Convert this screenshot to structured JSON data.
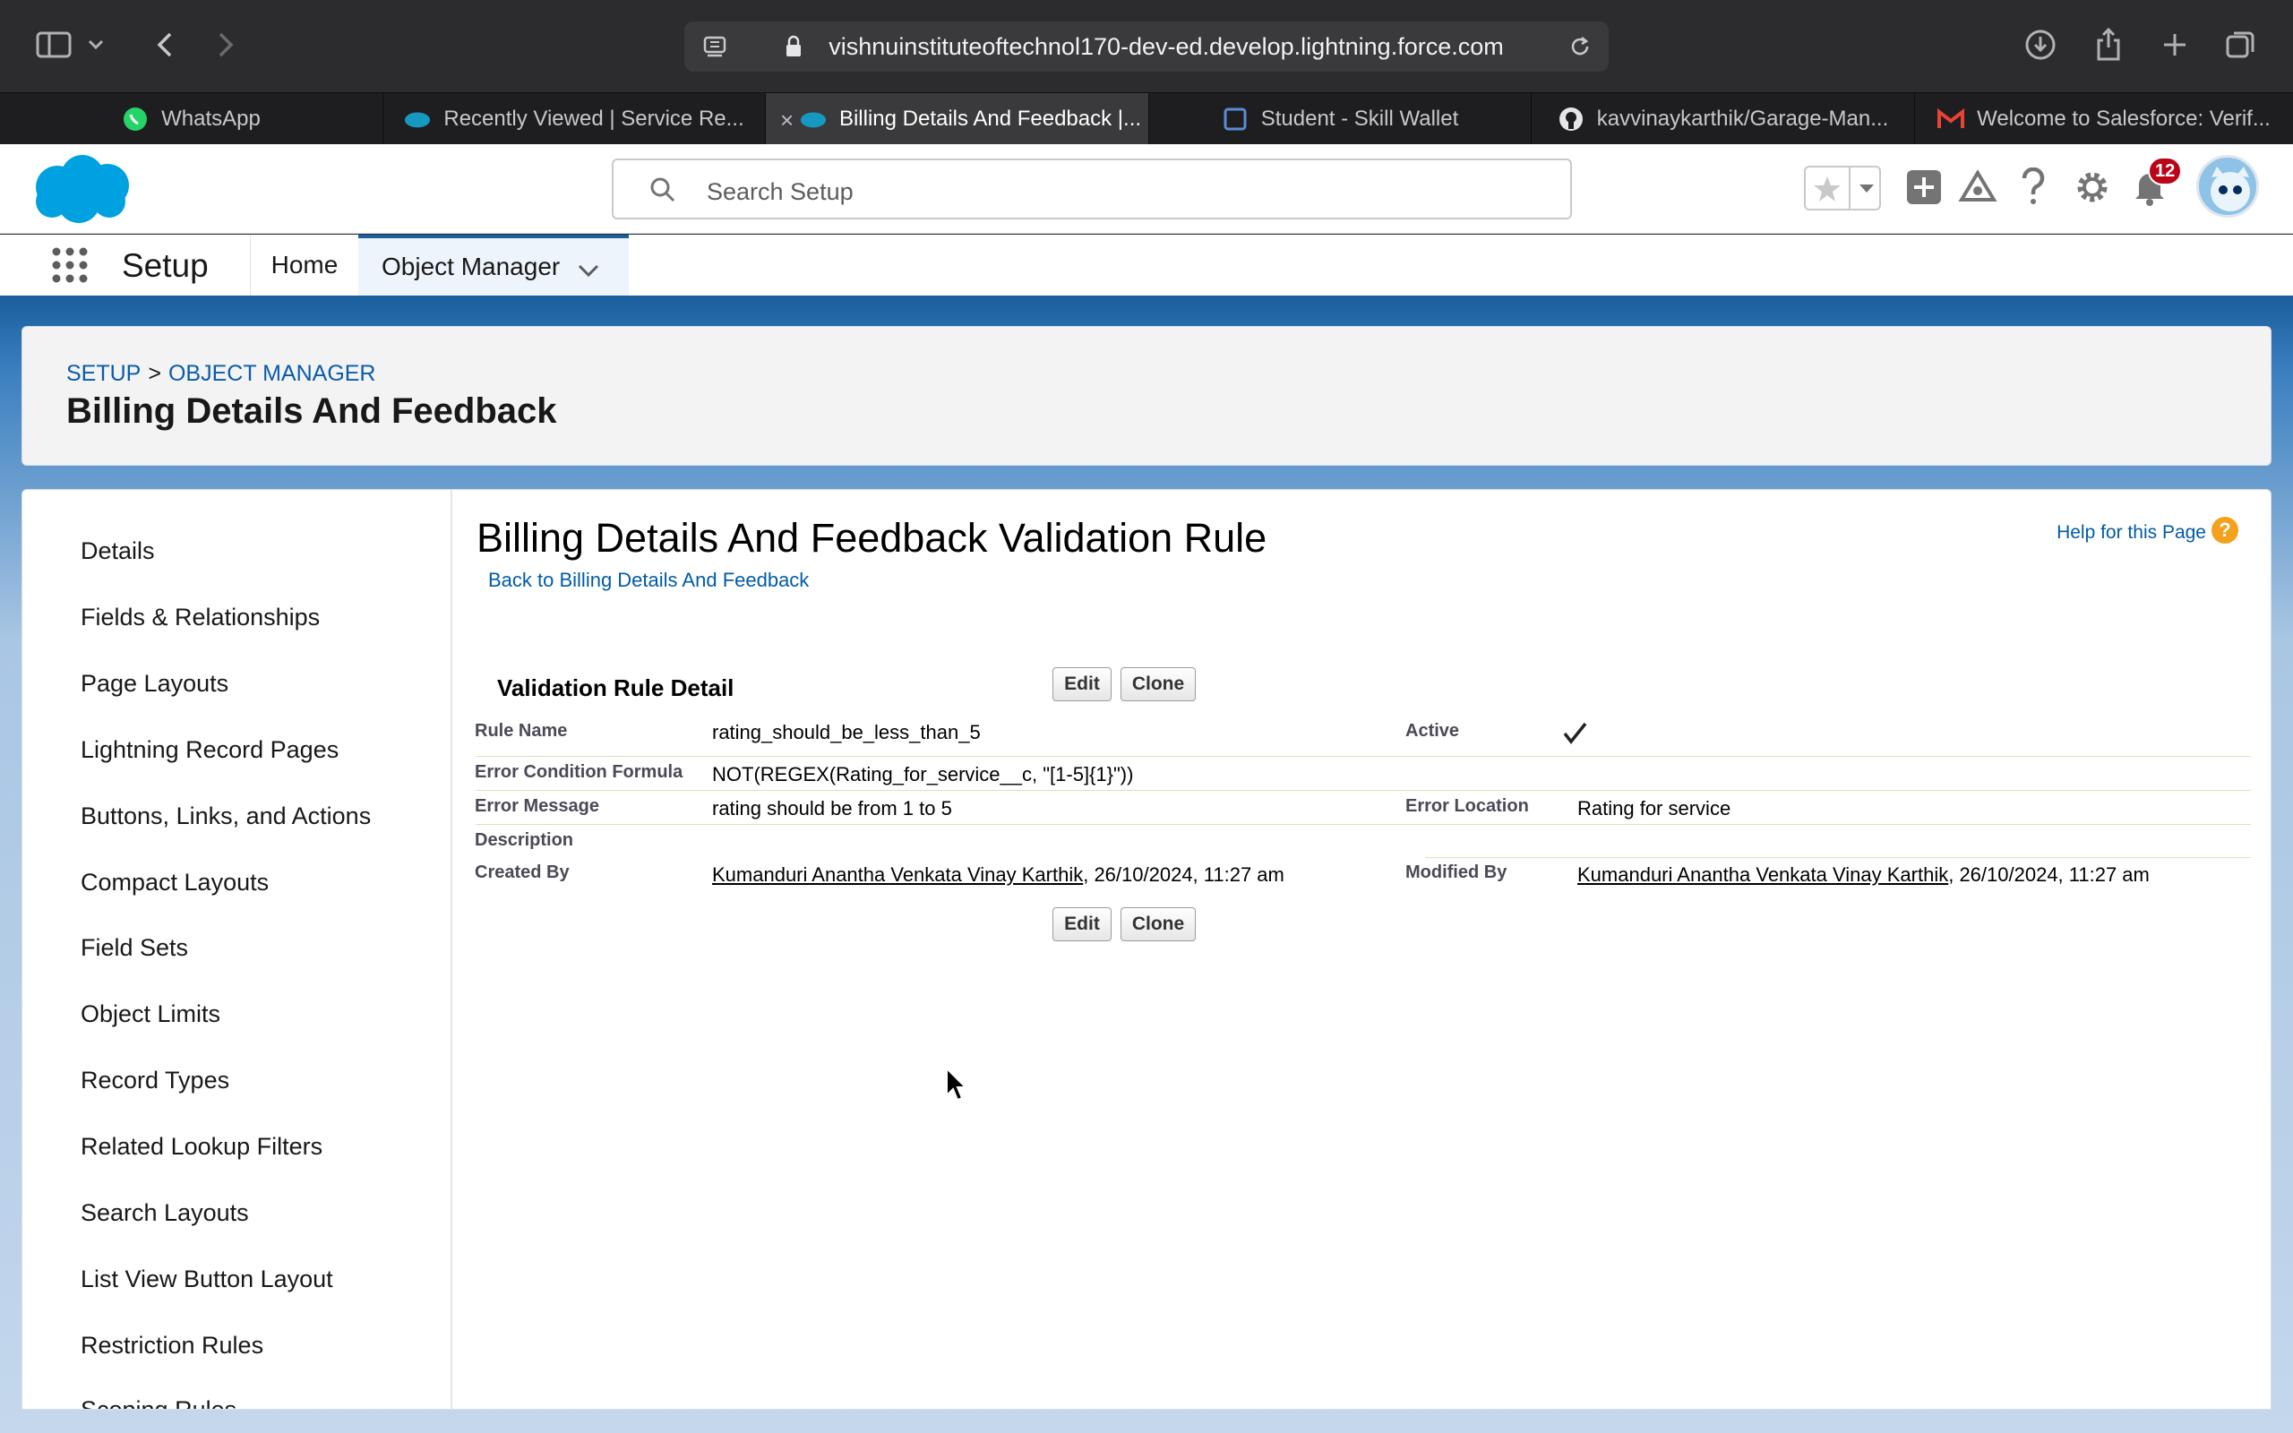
{
  "browser": {
    "url": "vishnuinstituteoftechnol170-dev-ed.develop.lightning.force.com",
    "tabs": [
      {
        "label": "WhatsApp",
        "icon": "whatsapp-icon"
      },
      {
        "label": "Recently Viewed | Service Re...",
        "icon": "salesforce-cloud-icon"
      },
      {
        "label": "Billing Details And Feedback |...",
        "icon": "salesforce-cloud-icon",
        "active": true
      },
      {
        "label": "Student - Skill Wallet",
        "icon": "skill-wallet-icon"
      },
      {
        "label": "kavvinaykarthik/Garage-Man...",
        "icon": "github-icon"
      },
      {
        "label": "Welcome to Salesforce: Verif...",
        "icon": "gmail-icon"
      }
    ]
  },
  "header": {
    "search_placeholder": "Search Setup",
    "notification_count": "12",
    "colors": {
      "brand": "#00a1e0",
      "accent": "#1b5f9e",
      "badge": "#ba0517"
    }
  },
  "nav": {
    "app_name": "Setup",
    "items": [
      {
        "label": "Home"
      },
      {
        "label": "Object Manager",
        "active": true
      }
    ]
  },
  "page_header": {
    "breadcrumb_setup": "SETUP",
    "breadcrumb_sep": ">",
    "breadcrumb_object_manager": "OBJECT MANAGER",
    "title": "Billing Details And Feedback"
  },
  "sidebar": {
    "items": [
      {
        "label": "Details"
      },
      {
        "label": "Fields & Relationships"
      },
      {
        "label": "Page Layouts"
      },
      {
        "label": "Lightning Record Pages"
      },
      {
        "label": "Buttons, Links, and Actions"
      },
      {
        "label": "Compact Layouts"
      },
      {
        "label": "Field Sets"
      },
      {
        "label": "Object Limits"
      },
      {
        "label": "Record Types"
      },
      {
        "label": "Related Lookup Filters"
      },
      {
        "label": "Search Layouts"
      },
      {
        "label": "List View Button Layout"
      },
      {
        "label": "Restriction Rules"
      },
      {
        "label": "Scoping Rules"
      }
    ]
  },
  "detail": {
    "title": "Billing Details And Feedback Validation Rule",
    "back_link": "Back to Billing Details And Feedback",
    "help_link": "Help for this Page",
    "section_title": "Validation Rule Detail",
    "edit_label": "Edit",
    "clone_label": "Clone",
    "fields": {
      "rule_name_label": "Rule Name",
      "rule_name": "rating_should_be_less_than_5",
      "active_label": "Active",
      "active": true,
      "formula_label": "Error Condition Formula",
      "formula": "NOT(REGEX(Rating_for_service__c, \"[1-5]{1}\"))",
      "error_message_label": "Error Message",
      "error_message": "rating should be from 1 to 5",
      "error_location_label": "Error Location",
      "error_location": "Rating for service",
      "description_label": "Description",
      "description": "",
      "created_by_label": "Created By",
      "created_by_user": "Kumanduri Anantha Venkata Vinay Karthik",
      "created_by_date": ", 26/10/2024, 11:27 am",
      "modified_by_label": "Modified By",
      "modified_by_user": "Kumanduri Anantha Venkata Vinay Karthik",
      "modified_by_date": ", 26/10/2024, 11:27 am"
    }
  }
}
